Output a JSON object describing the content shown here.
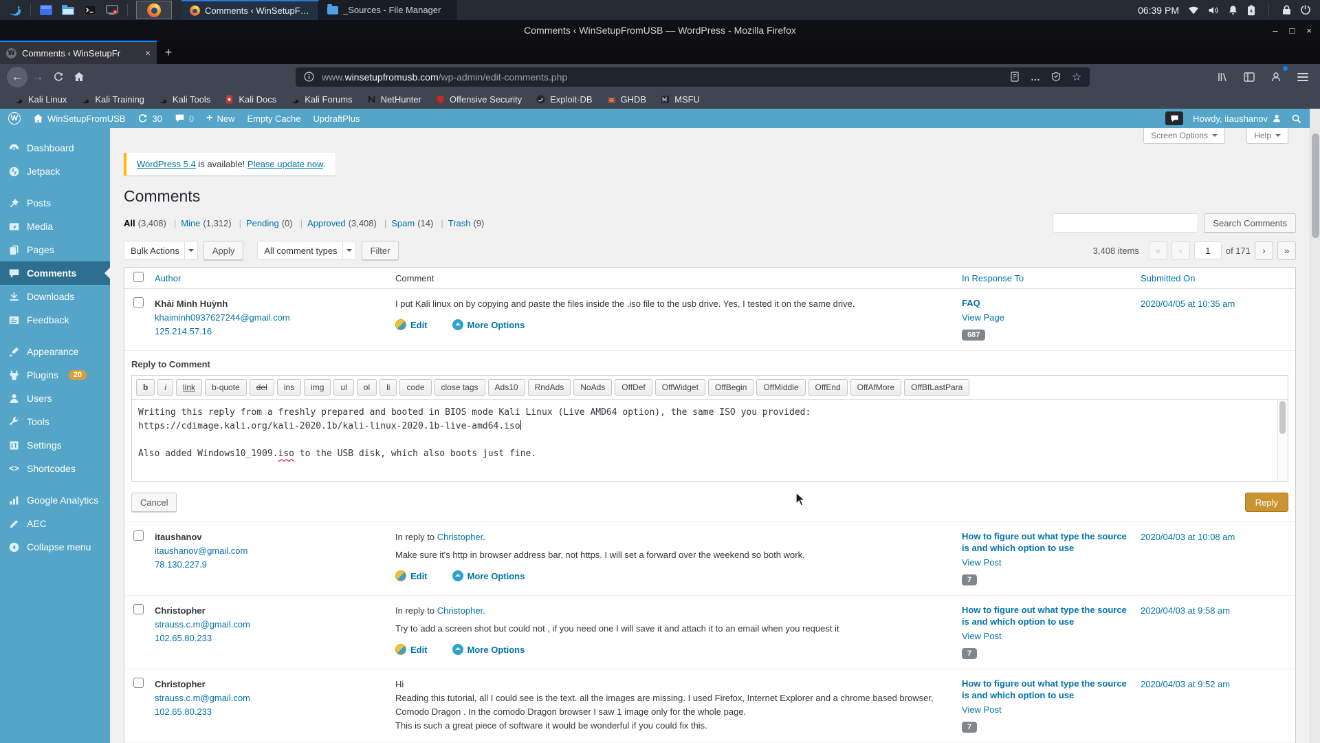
{
  "icons": {
    "back": "←",
    "forward": "→",
    "dots": "…",
    "star": "☆",
    "min": "–",
    "max": "□",
    "close": "×",
    "tab_close": "×",
    "new_tab": "+",
    "plus_new": "+",
    "w_glyph": "W",
    "shortcodes_glyph": "<>"
  },
  "system_bar": {
    "clock": "06:39 PM",
    "task1": "Comments ‹ WinSetupF…",
    "task2": "_Sources - File Manager"
  },
  "browser": {
    "window_title": "Comments ‹ WinSetupFromUSB — WordPress - Mozilla Firefox",
    "tab_title": "Comments ‹ WinSetupFr",
    "url_prefix": "www.",
    "url_domain": "winsetupfromusb.com",
    "url_path": "/wp-admin/edit-comments.php",
    "bookmarks": [
      "Kali Linux",
      "Kali Training",
      "Kali Tools",
      "Kali Docs",
      "Kali Forums",
      "NetHunter",
      "Offensive Security",
      "Exploit-DB",
      "GHDB",
      "MSFU"
    ]
  },
  "admin_bar": {
    "site": "WinSetupFromUSB",
    "updates": "30",
    "comments": "0",
    "new_label": "New",
    "empty_cache": "Empty Cache",
    "updraft": "UpdraftPlus",
    "howdy": "Howdy, itaushanov"
  },
  "sidebar": {
    "dashboard": "Dashboard",
    "jetpack": "Jetpack",
    "posts": "Posts",
    "media": "Media",
    "pages": "Pages",
    "comments": "Comments",
    "downloads": "Downloads",
    "feedback": "Feedback",
    "appearance": "Appearance",
    "plugins": "Plugins",
    "plugins_badge": "20",
    "users": "Users",
    "tools": "Tools",
    "settings": "Settings",
    "shortcodes": "Shortcodes",
    "analytics": "Google Analytics",
    "aec": "AEC",
    "collapse": "Collapse menu"
  },
  "page": {
    "notice_link": "WordPress 5.4",
    "notice_text": " is available! ",
    "notice_action": "Please update now",
    "notice_period": ".",
    "title": "Comments",
    "screen_options": "Screen Options",
    "help": "Help",
    "filter_all": "All",
    "filter_all_count": "(3,408)",
    "filter_mine": "Mine",
    "filter_mine_count": "(1,312)",
    "filter_pending": "Pending",
    "filter_pending_count": "(0)",
    "filter_approved": "Approved",
    "filter_approved_count": "(3,408)",
    "filter_spam": "Spam",
    "filter_spam_count": "(14)",
    "filter_trash": "Trash",
    "filter_trash_count": "(9)",
    "search_button": "Search Comments",
    "bulk_actions": "Bulk Actions",
    "apply": "Apply",
    "comment_types": "All comment types",
    "filter_button": "Filter",
    "items": "3,408 items",
    "first": "«",
    "prev": "‹",
    "page_value": "1",
    "of_pages": "of 171",
    "next": "›",
    "last": "»",
    "col_author": "Author",
    "col_comment": "Comment",
    "col_response": "In Response To",
    "col_submitted": "Submitted On"
  },
  "reply": {
    "label": "Reply to Comment",
    "buttons": [
      "b",
      "i",
      "link",
      "b-quote",
      "del",
      "ins",
      "img",
      "ul",
      "ol",
      "li",
      "code",
      "close tags",
      "Ads10",
      "RndAds",
      "NoAds",
      "OffDef",
      "OffWidget",
      "OffBegin",
      "OffMiddle",
      "OffEnd",
      "OffAfMore",
      "OffBfLastPara"
    ],
    "line1": "Writing this reply from a freshly prepared and booted in BIOS mode Kali Linux (Live AMD64 option), the same ISO you provided:",
    "line2": "https://cdimage.kali.org/kali-2020.1b/kali-linux-2020.1b-live-amd64.iso",
    "line4_pre": "Also added Windows10_1909.",
    "line4_typo": "iso",
    "line4_post": " to the USB disk, which also boots just fine.",
    "cancel": "Cancel",
    "submit": "Reply"
  },
  "comments": [
    {
      "author": "Khải Minh Huỳnh",
      "email": "khaiminh0937627244@gmail.com",
      "ip": "125.214.57.16",
      "text": "I put Kali linux on by copying and paste the files inside the .iso file to the usb drive. Yes, I tested it on the same drive.",
      "edit": "Edit",
      "more": "More Options",
      "post": "FAQ",
      "view": "View Page",
      "count": "687",
      "date": "2020/04/05 at 10:35 am"
    },
    {
      "author": "itaushanov",
      "email": "itaushanov@gmail.com",
      "ip": "78.130.227.9",
      "reply_label": "In reply to ",
      "reply_name": "Christopher",
      "reply_period": ".",
      "text": "Make sure it's http in browser address bar, not https. I will set a forward over the weekend so both work.",
      "edit": "Edit",
      "more": "More Options",
      "post": "How to figure out what type the source is and which option to use",
      "view": "View Post",
      "count": "7",
      "date": "2020/04/03 at 10:08 am"
    },
    {
      "author": "Christopher",
      "email": "strauss.c.m@gmail.com",
      "ip": "102.65.80.233",
      "reply_label": "In reply to ",
      "reply_name": "Christopher",
      "reply_period": ".",
      "text": "Try to add a screen shot but could not , if you need one I will save it and attach it to an email when you request it",
      "edit": "Edit",
      "more": "More Options",
      "post": "How to figure out what type the source is and which option to use",
      "view": "View Post",
      "count": "7",
      "date": "2020/04/03 at 9:58 am"
    },
    {
      "author": "Christopher",
      "email": "strauss.c.m@gmail.com",
      "ip": "102.65.80.233",
      "text1": "Hi",
      "text2": "Reading this tutorial, all I could see is the text. all the images are missing. I used Firefox, Internet Explorer and a chrome based browser, Comodo Dragon . In the comodo Dragon browser I saw 1 image only for the whole page.",
      "text3": "This is such a great piece of software it would be wonderful if you could fix this.",
      "post": "How to figure out what type the source is and which option to use",
      "view": "View Post",
      "count": "7",
      "date": "2020/04/03 at 9:52 am"
    }
  ],
  "colors": {
    "admin_blue": "#54a5c7",
    "active_item": "#2c6f91",
    "link_blue": "#0073aa",
    "badge_orange": "#dd9d33",
    "notice_yellow": "#ffb900",
    "reply_button": "#ca9531",
    "tab_accent": "#0a84ff"
  }
}
